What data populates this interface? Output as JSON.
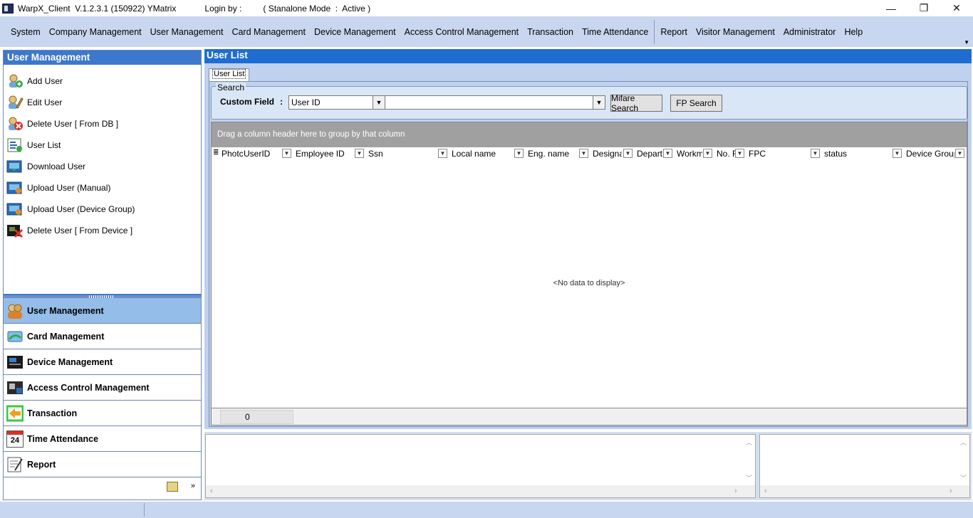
{
  "window": {
    "title": "WarpX_Client  V.1.2.3.1 (150922) YMatrix",
    "login_label": "Login by :",
    "mode": "( Stanalone Mode  :  Active )",
    "minimize": "—",
    "restore": "❐",
    "close": "✕"
  },
  "menu": {
    "items_left": [
      "System",
      "Company Management",
      "User Management",
      "Card Management",
      "Device Management",
      "Access Control Management",
      "Transaction",
      "Time Attendance"
    ],
    "items_right": [
      "Report",
      "Visitor Management",
      "Administrator",
      "Help"
    ]
  },
  "left_panel": {
    "title": "User Management",
    "tasks": [
      {
        "label": "Add User",
        "icon": "add-user-icon"
      },
      {
        "label": "Edit User",
        "icon": "edit-user-icon"
      },
      {
        "label": "Delete User [ From DB ]",
        "icon": "delete-user-icon"
      },
      {
        "label": "User List",
        "icon": "user-list-icon"
      },
      {
        "label": "Download User",
        "icon": "download-user-icon"
      },
      {
        "label": "Upload User (Manual)",
        "icon": "upload-user-icon"
      },
      {
        "label": "Upload User (Device Group)",
        "icon": "upload-group-icon"
      },
      {
        "label": "Delete User [ From Device ]",
        "icon": "delete-device-user-icon"
      }
    ],
    "nav": [
      {
        "label": "User Management",
        "icon": "users-icon",
        "active": true
      },
      {
        "label": "Card Management",
        "icon": "card-icon",
        "active": false
      },
      {
        "label": "Device Management",
        "icon": "device-icon",
        "active": false
      },
      {
        "label": "Access Control Management",
        "icon": "access-control-icon",
        "active": false
      },
      {
        "label": "Transaction",
        "icon": "transaction-icon",
        "active": false
      },
      {
        "label": "Time Attendance",
        "icon": "calendar-icon",
        "active": false
      },
      {
        "label": "Report",
        "icon": "report-icon",
        "active": false
      }
    ],
    "calendar_day": "24"
  },
  "main": {
    "title": "User List",
    "tab_label": "User List",
    "search": {
      "legend": "Search",
      "custom_field_label": "Custom Field",
      "colon": ":",
      "field_value": "User ID",
      "value_text": "",
      "mifare_button": "Mifare Search",
      "fp_button": "FP Search"
    },
    "grid": {
      "group_hint": "Drag a column header here to group by that column",
      "columns": [
        "Photc",
        "UserID",
        "Employee ID",
        "Ssn",
        "Local name",
        "Eng. name",
        "Designat",
        "Departr",
        "Workm",
        "No. F",
        "FPC",
        "status",
        "Device Group"
      ],
      "empty_text": "<No data to display>",
      "record_count": "0"
    }
  }
}
